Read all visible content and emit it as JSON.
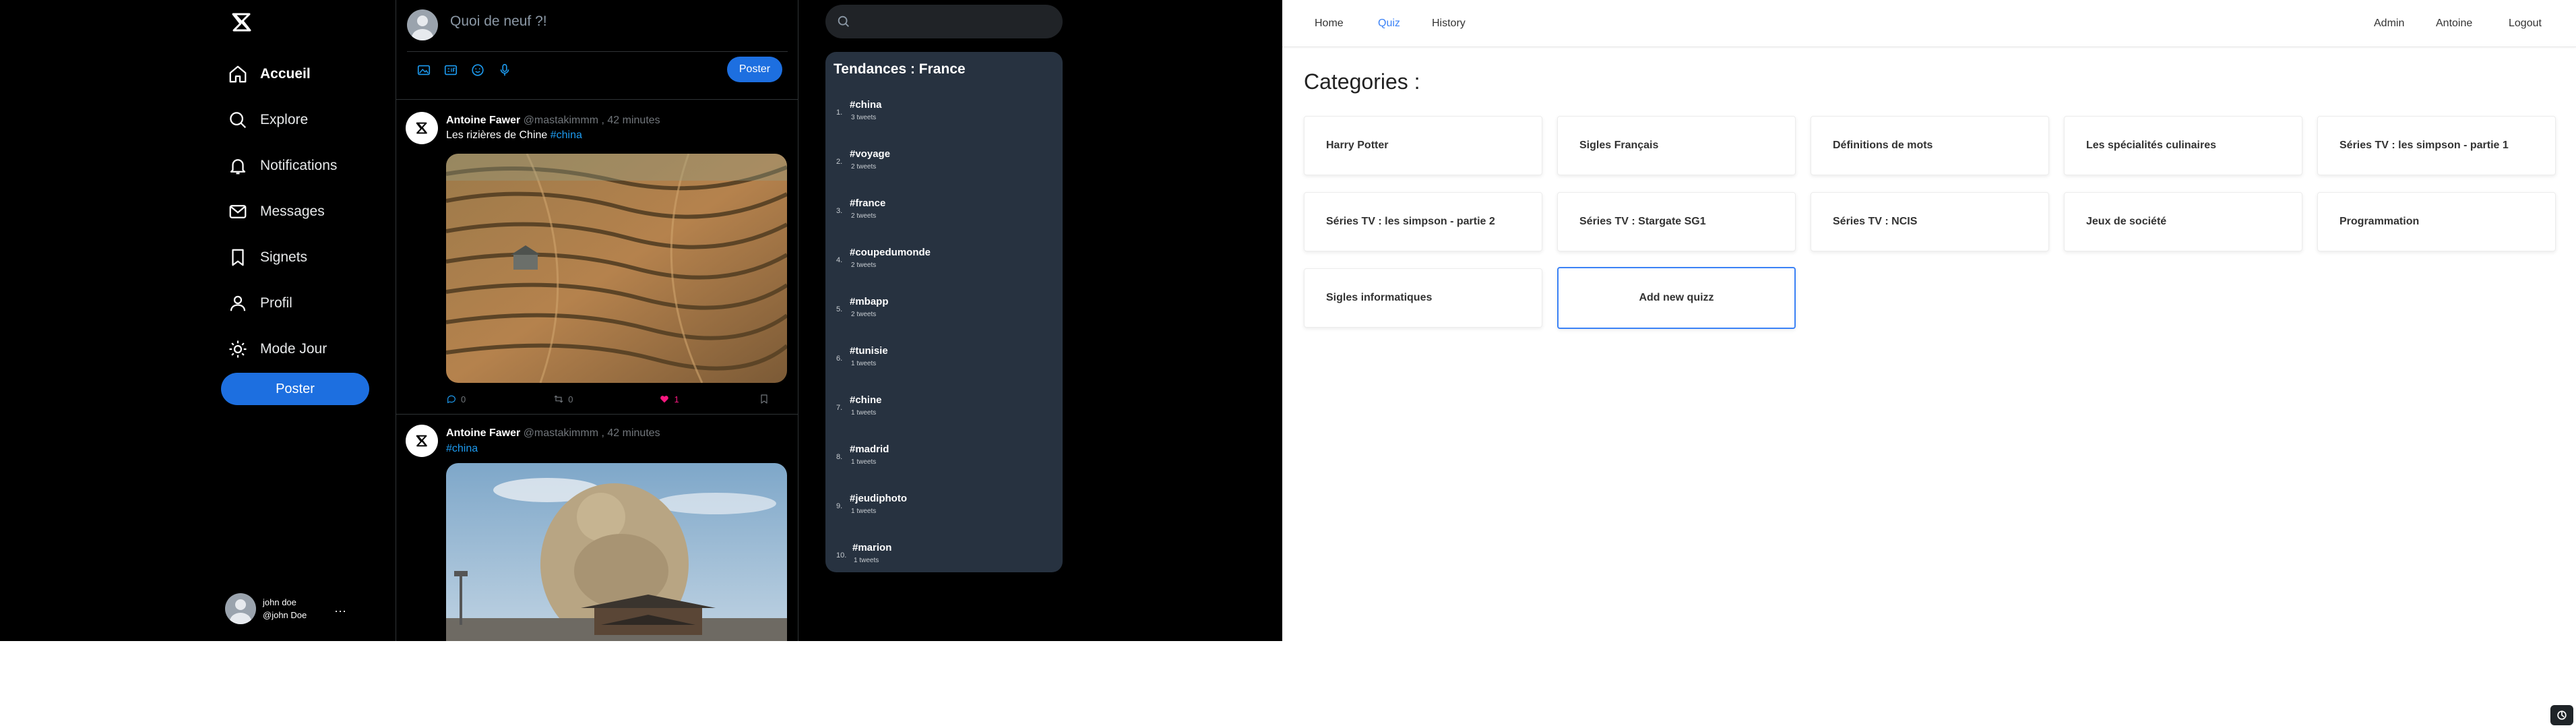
{
  "social": {
    "nav": [
      {
        "label": "Accueil",
        "icon": "home-icon",
        "active": true
      },
      {
        "label": "Explore",
        "icon": "search-icon"
      },
      {
        "label": "Notifications",
        "icon": "bell-icon"
      },
      {
        "label": "Messages",
        "icon": "mail-icon"
      },
      {
        "label": "Signets",
        "icon": "bookmark-icon"
      },
      {
        "label": "Profil",
        "icon": "user-icon"
      },
      {
        "label": "Mode Jour",
        "icon": "sun-icon"
      }
    ],
    "post_button": "Poster",
    "user": {
      "name": "john doe",
      "handle": "@john Doe",
      "more": "···"
    },
    "compose": {
      "placeholder": "Quoi de neuf ?!",
      "post_button": "Poster"
    },
    "tweets": [
      {
        "name": "Antoine Fawer",
        "handle": "@mastakimmm",
        "time": ", 42 minutes",
        "text": "Les rizières de Chine ",
        "hashtag": "#china",
        "replies": "0",
        "retweets": "0",
        "likes": "1"
      },
      {
        "name": "Antoine Fawer",
        "handle": "@mastakimmm",
        "time": ", 42 minutes",
        "text": "",
        "hashtag": "#china"
      }
    ],
    "trends": {
      "title": "Tendances : France",
      "items": [
        {
          "rank": "1.",
          "tag": "#china",
          "count": "3 tweets"
        },
        {
          "rank": "2.",
          "tag": "#voyage",
          "count": "2 tweets"
        },
        {
          "rank": "3.",
          "tag": "#france",
          "count": "2 tweets"
        },
        {
          "rank": "4.",
          "tag": "#coupedumonde",
          "count": "2 tweets"
        },
        {
          "rank": "5.",
          "tag": "#mbapp",
          "count": "2 tweets"
        },
        {
          "rank": "6.",
          "tag": "#tunisie",
          "count": "1 tweets"
        },
        {
          "rank": "7.",
          "tag": "#chine",
          "count": "1 tweets"
        },
        {
          "rank": "8.",
          "tag": "#madrid",
          "count": "1 tweets"
        },
        {
          "rank": "9.",
          "tag": "#jeudiphoto",
          "count": "1 tweets"
        },
        {
          "rank": "10.",
          "tag": "#marion",
          "count": "1 tweets"
        }
      ]
    }
  },
  "quiz": {
    "nav": {
      "home": "Home",
      "quiz": "Quiz",
      "history": "History",
      "admin": "Admin",
      "user": "Antoine",
      "logout": "Logout"
    },
    "title": "Categories :",
    "categories": [
      "Harry Potter",
      "Sigles Français",
      "Définitions de mots",
      "Les spécialités culinaires",
      "Séries TV : les simpson - partie 1",
      "Séries TV : les simpson - partie 2",
      "Séries TV : Stargate SG1",
      "Séries TV : NCIS",
      "Jeux de société",
      "Programmation",
      "Sigles informatiques"
    ],
    "add_button": "Add new quizz"
  },
  "colors": {
    "accent": "#1d6fe0",
    "hashtag": "#1d9bf0",
    "quiz_active": "#3b82f6",
    "like": "#f91880"
  }
}
